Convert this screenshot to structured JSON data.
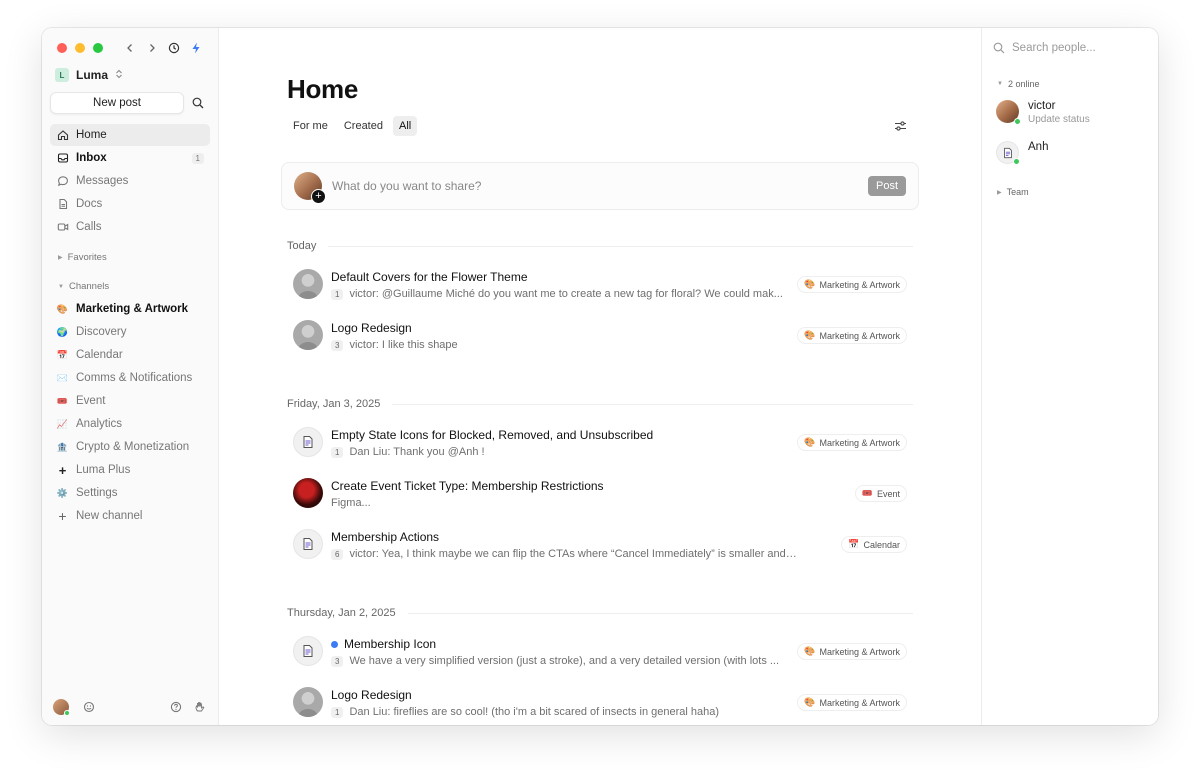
{
  "sidebar": {
    "workspace": {
      "initial": "L",
      "name": "Luma"
    },
    "new_post_label": "New post",
    "nav": [
      {
        "label": "Home",
        "icon": "home-icon",
        "active": true
      },
      {
        "label": "Inbox",
        "icon": "inbox-icon",
        "bold": true,
        "count": "1"
      },
      {
        "label": "Messages",
        "icon": "message-icon"
      },
      {
        "label": "Docs",
        "icon": "doc-icon"
      },
      {
        "label": "Calls",
        "icon": "video-icon"
      }
    ],
    "favorites_label": "Favorites",
    "channels_label": "Channels",
    "channels": [
      {
        "label": "Marketing & Artwork",
        "emoji": "🎨",
        "bold": true
      },
      {
        "label": "Discovery",
        "emoji": "🌍"
      },
      {
        "label": "Calendar",
        "emoji": "📅"
      },
      {
        "label": "Comms & Notifications",
        "emoji": "✉️"
      },
      {
        "label": "Event",
        "emoji": "🎟️"
      },
      {
        "label": "Analytics",
        "emoji": "📈"
      },
      {
        "label": "Crypto & Monetization",
        "emoji": "🏦"
      },
      {
        "label": "Luma Plus",
        "emoji": "+"
      },
      {
        "label": "Settings",
        "emoji": "⚙️"
      },
      {
        "label": "New channel",
        "emoji": "+"
      }
    ]
  },
  "main": {
    "title": "Home",
    "tabs": [
      {
        "label": "For me"
      },
      {
        "label": "Created"
      },
      {
        "label": "All",
        "active": true
      }
    ],
    "composer": {
      "placeholder": "What do you want to share?",
      "post_label": "Post"
    },
    "groups": [
      {
        "label": "Today",
        "items": [
          {
            "title": "Default Covers for the Flower Theme",
            "count": "1",
            "preview": "victor: @Guillaume Miché do you want me to create a new tag for floral? We could mak...",
            "tag": "Marketing & Artwork",
            "tag_emoji": "🎨",
            "avatar": "photo"
          },
          {
            "title": "Logo Redesign",
            "count": "3",
            "preview": "victor: I like this shape",
            "tag": "Marketing & Artwork",
            "tag_emoji": "🎨",
            "avatar": "photo"
          }
        ]
      },
      {
        "label": "Friday, Jan 3, 2025",
        "items": [
          {
            "title": "Empty State Icons for Blocked, Removed, and Unsubscribed",
            "count": "1",
            "preview": "Dan Liu: Thank you @Anh !",
            "tag": "Marketing & Artwork",
            "tag_emoji": "🎨",
            "avatar": "doc"
          },
          {
            "title": "Create Event Ticket Type: Membership Restrictions",
            "count": "",
            "preview": "Figma...",
            "tag": "Event",
            "tag_emoji": "🎟️",
            "avatar": "red"
          },
          {
            "title": "Membership Actions",
            "count": "6",
            "preview": "victor: Yea, I think maybe we can flip the CTAs where “Cancel Immediately” is smaller and is not ...",
            "tag": "Calendar",
            "tag_emoji": "📅",
            "avatar": "doc"
          }
        ]
      },
      {
        "label": "Thursday, Jan 2, 2025",
        "items": [
          {
            "title": "Membership Icon",
            "count": "3",
            "preview": "We have a very simplified version (just a stroke), and a very detailed version (with lots ...",
            "tag": "Marketing & Artwork",
            "tag_emoji": "🎨",
            "avatar": "doc",
            "unread": true
          },
          {
            "title": "Logo Redesign",
            "count": "1",
            "preview": "Dan Liu: fireflies are so cool! (tho i'm a bit scared of insects in general haha)",
            "tag": "Marketing & Artwork",
            "tag_emoji": "🎨",
            "avatar": "photo"
          }
        ]
      }
    ]
  },
  "right": {
    "search_placeholder": "Search people...",
    "online_label": "2 online",
    "people": [
      {
        "name": "victor",
        "status": "Update status"
      },
      {
        "name": "Anh",
        "status": ""
      }
    ],
    "team_label": "Team"
  },
  "colors": {
    "accent_unread": "#3d7bf5",
    "online": "#3cc85a"
  }
}
